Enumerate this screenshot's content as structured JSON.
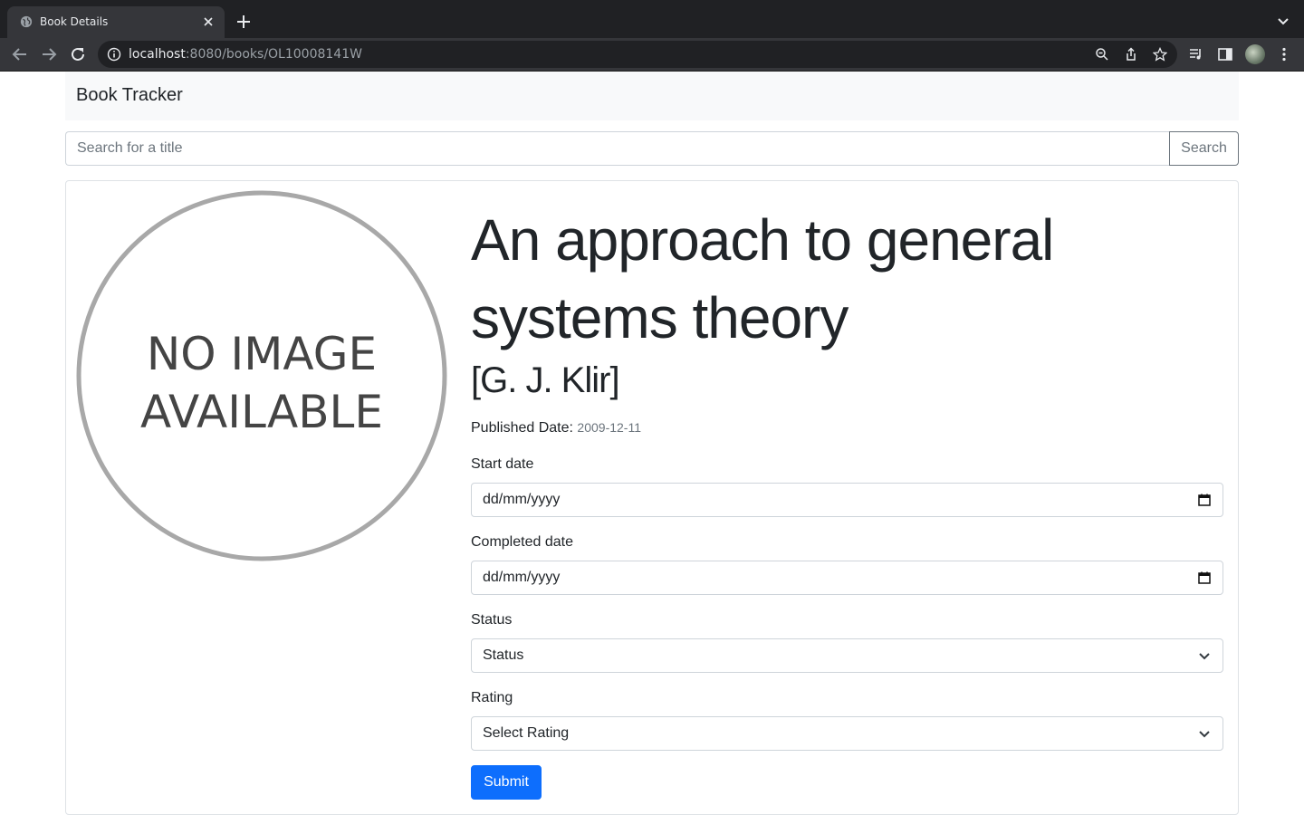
{
  "browser": {
    "tab_title": "Book Details",
    "url_host": "localhost",
    "url_path": ":8080/books/OL10008141W"
  },
  "app": {
    "brand": "Book Tracker"
  },
  "search": {
    "placeholder": "Search for a title",
    "button_label": "Search"
  },
  "book": {
    "cover_text_line1": "NO IMAGE",
    "cover_text_line2": "AVAILABLE",
    "title": "An approach to general systems theory",
    "author": "[G. J. Klir]",
    "published_label": "Published Date:",
    "published_value": "2009-12-11"
  },
  "form": {
    "start_date_label": "Start date",
    "start_date_value": "dd/mm/yyyy",
    "completed_date_label": "Completed date",
    "completed_date_value": "dd/mm/yyyy",
    "status_label": "Status",
    "status_value": "Status",
    "rating_label": "Rating",
    "rating_value": "Select Rating",
    "submit_label": "Submit"
  },
  "colors": {
    "primary": "#0d6efd",
    "chrome_dark": "#202124",
    "navbar_bg": "#f8f9fa"
  }
}
